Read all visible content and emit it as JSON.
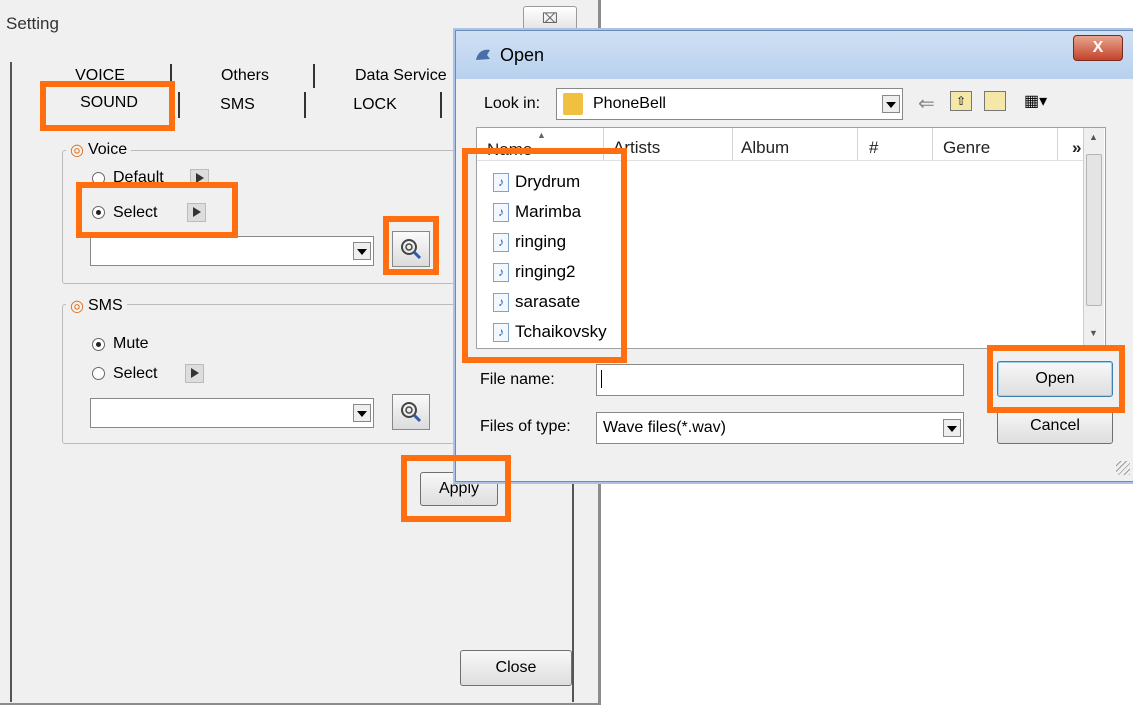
{
  "setting_window": {
    "title": "Setting",
    "close_glyph": "⌧",
    "tabs_row1": [
      "VOICE",
      "Others",
      "Data Service"
    ],
    "tabs_row2": [
      "SOUND",
      "SMS",
      "LOCK"
    ],
    "active_tab": "SOUND",
    "voice_group": {
      "label": "Voice",
      "option_default": "Default",
      "option_select": "Select",
      "selected": "Select",
      "file_value": ""
    },
    "sms_group": {
      "label": "SMS",
      "option_mute": "Mute",
      "option_select": "Select",
      "selected": "Mute",
      "file_value": ""
    },
    "apply_label": "Apply",
    "close_label": "Close"
  },
  "open_dialog": {
    "title": "Open",
    "close_glyph": "X",
    "look_in_label": "Look in:",
    "look_in_value": "PhoneBell",
    "columns": [
      "Name",
      "Artists",
      "Album",
      "#",
      "Genre",
      "»"
    ],
    "files": [
      "Drydrum",
      "Marimba",
      "ringing",
      "ringing2",
      "sarasate",
      "Tchaikovsky"
    ],
    "file_name_label": "File name:",
    "file_name_value": "",
    "files_of_type_label": "Files of type:",
    "files_of_type_value": "Wave files(*.wav)",
    "open_label": "Open",
    "cancel_label": "Cancel"
  },
  "colors": {
    "highlight": "#ff6e0f",
    "folder": "#f0c040",
    "titlebar": "#b9d1ee"
  },
  "icons": [
    "settings-icon",
    "folder-icon",
    "back-arrow-icon",
    "up-folder-icon",
    "new-folder-icon",
    "view-menu-icon",
    "music-file-icon",
    "browse-icon",
    "play-icon"
  ]
}
